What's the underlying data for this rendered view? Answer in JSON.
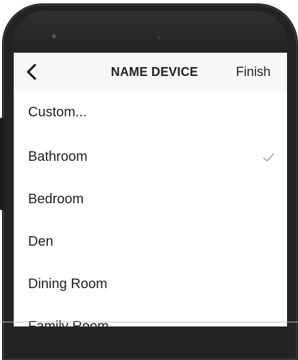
{
  "header": {
    "back_icon": "chevron-left-icon",
    "title": "NAME DEVICE",
    "finish_label": "Finish"
  },
  "rooms": [
    {
      "label": "Custom..."
    },
    {
      "label": "Bathroom",
      "selected": true
    },
    {
      "label": "Bedroom"
    },
    {
      "label": "Den"
    },
    {
      "label": "Dining Room"
    },
    {
      "label": "Family Room"
    }
  ],
  "colors": {
    "phone_body": "#232323",
    "nav_background": "#f7f7f7",
    "text": "#1e1e1e",
    "checkmark": "#9a9a9a"
  }
}
